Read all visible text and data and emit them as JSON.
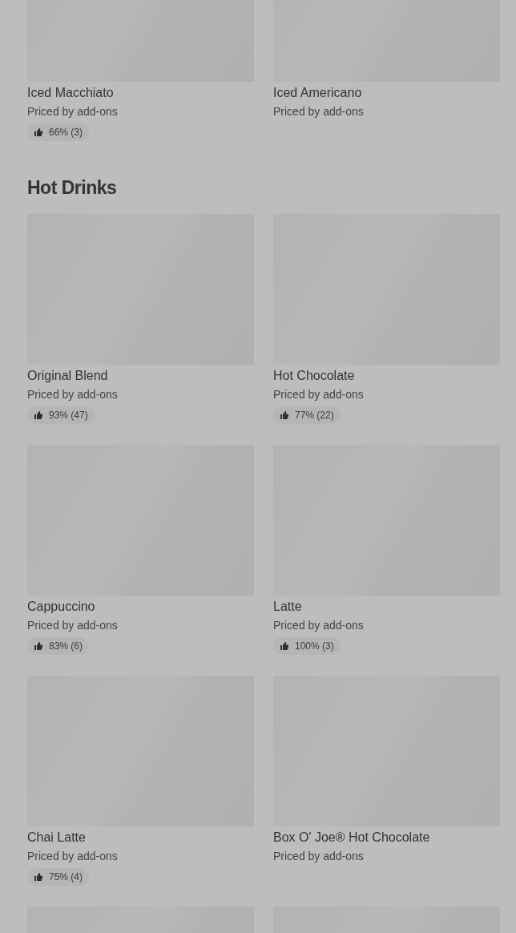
{
  "sections": [
    {
      "items": [
        {
          "kind": "product",
          "name": "Iced Macchiato",
          "price": "Priced by add-ons",
          "rating": "66% (3)"
        },
        {
          "kind": "product",
          "name": "Iced Americano",
          "price": "Priced by add-ons"
        }
      ]
    },
    {
      "title": "Hot Drinks",
      "items": [
        {
          "kind": "product",
          "name": "Original Blend",
          "price": "Priced by add-ons",
          "rating": "93% (47)"
        },
        {
          "kind": "product",
          "name": "Hot Chocolate",
          "price": "Priced by add-ons",
          "rating": "77% (22)"
        },
        {
          "kind": "product",
          "name": "Cappuccino",
          "price": "Priced by add-ons",
          "rating": "83% (6)"
        },
        {
          "kind": "product",
          "name": "Latte",
          "price": "Priced by add-ons",
          "rating": "100% (3)"
        },
        {
          "kind": "product",
          "name": "Chai Latte",
          "price": "Priced by add-ons",
          "rating": "75% (4)"
        },
        {
          "kind": "product",
          "name": "Box O' Joe® Hot Chocolate",
          "price": "Priced by add-ons"
        },
        {
          "kind": "image_only"
        },
        {
          "kind": "image_only"
        }
      ]
    }
  ]
}
